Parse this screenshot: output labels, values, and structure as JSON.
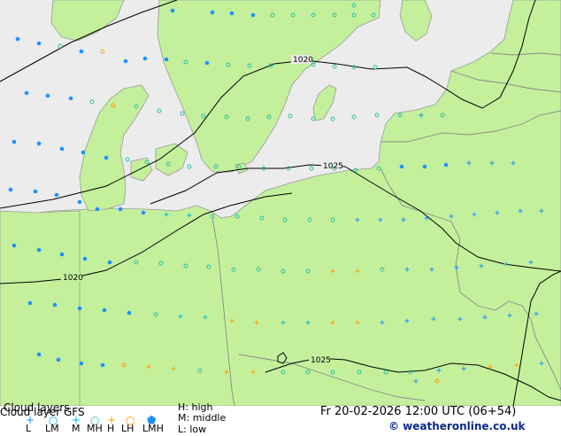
{
  "title": "Cloud layers",
  "subtitle": "Cloud layer GFS",
  "model_levels": {
    "high": "H: high",
    "middle": "M: middle",
    "low": "L: low"
  },
  "datetime": "Fr 20-02-2026 12:00 UTC (06+54)",
  "copyright": "© weatheronline.co.uk",
  "legend": [
    {
      "label": "L",
      "symbol": "plus",
      "color": "#1e90ff"
    },
    {
      "label": "LM",
      "symbol": "circle",
      "color": "#00a0ff"
    },
    {
      "label": "M",
      "symbol": "plus",
      "color": "#00bcd4"
    },
    {
      "label": "MH",
      "symbol": "circle",
      "color": "#20c0a0"
    },
    {
      "label": "H",
      "symbol": "plus",
      "color": "#ffa000"
    },
    {
      "label": "LH",
      "symbol": "circle",
      "color": "#ff9000"
    },
    {
      "label": "LMH",
      "symbol": "pentagon",
      "color": "#1e90ff"
    }
  ],
  "isobars": [
    "1020",
    "1025",
    "1020",
    "1025"
  ],
  "colors": {
    "land": "#c4f09c",
    "sea": "#ececec",
    "border": "#8a8a8a",
    "isobar": "#000000"
  }
}
